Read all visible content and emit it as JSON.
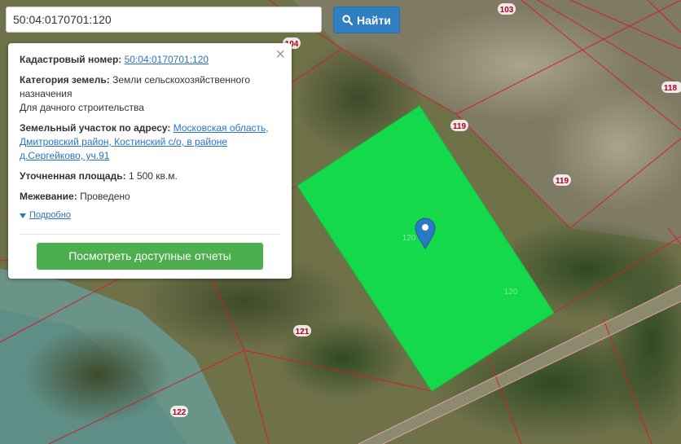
{
  "search": {
    "value": "50:04:0170701:120",
    "button_label": "Найти",
    "button_icon": "search-icon"
  },
  "popup": {
    "cadastral_label": "Кадастровый номер:",
    "cadastral_value": "50:04:0170701:120",
    "category_label": "Категория земель:",
    "category_value_1": "Земли сельскохозяйственного",
    "category_value_2": "назначения",
    "category_value_3": "Для дачного строительства",
    "address_label": "Земельный участок по адресу:",
    "address_value_1": "Московская область,",
    "address_value_2": "Дмитровский район, Костинский с/о, в районе",
    "address_value_3": "д.Сергейково, уч.91",
    "area_label": "Уточненная площадь:",
    "area_value": "1 500 кв.м.",
    "survey_label": "Межевание:",
    "survey_value": "Проведено",
    "more_label": "Подробно",
    "reports_button": "Посмотреть доступные отчеты",
    "close_icon": "close-icon"
  },
  "map": {
    "parcel_labels": [
      "103",
      "104",
      "118",
      "119",
      "119",
      "120",
      "120",
      "121",
      "122"
    ],
    "highlight_color": "#14d94b",
    "boundary_color": "#d0202a",
    "marker_color": "#2b78c5"
  }
}
